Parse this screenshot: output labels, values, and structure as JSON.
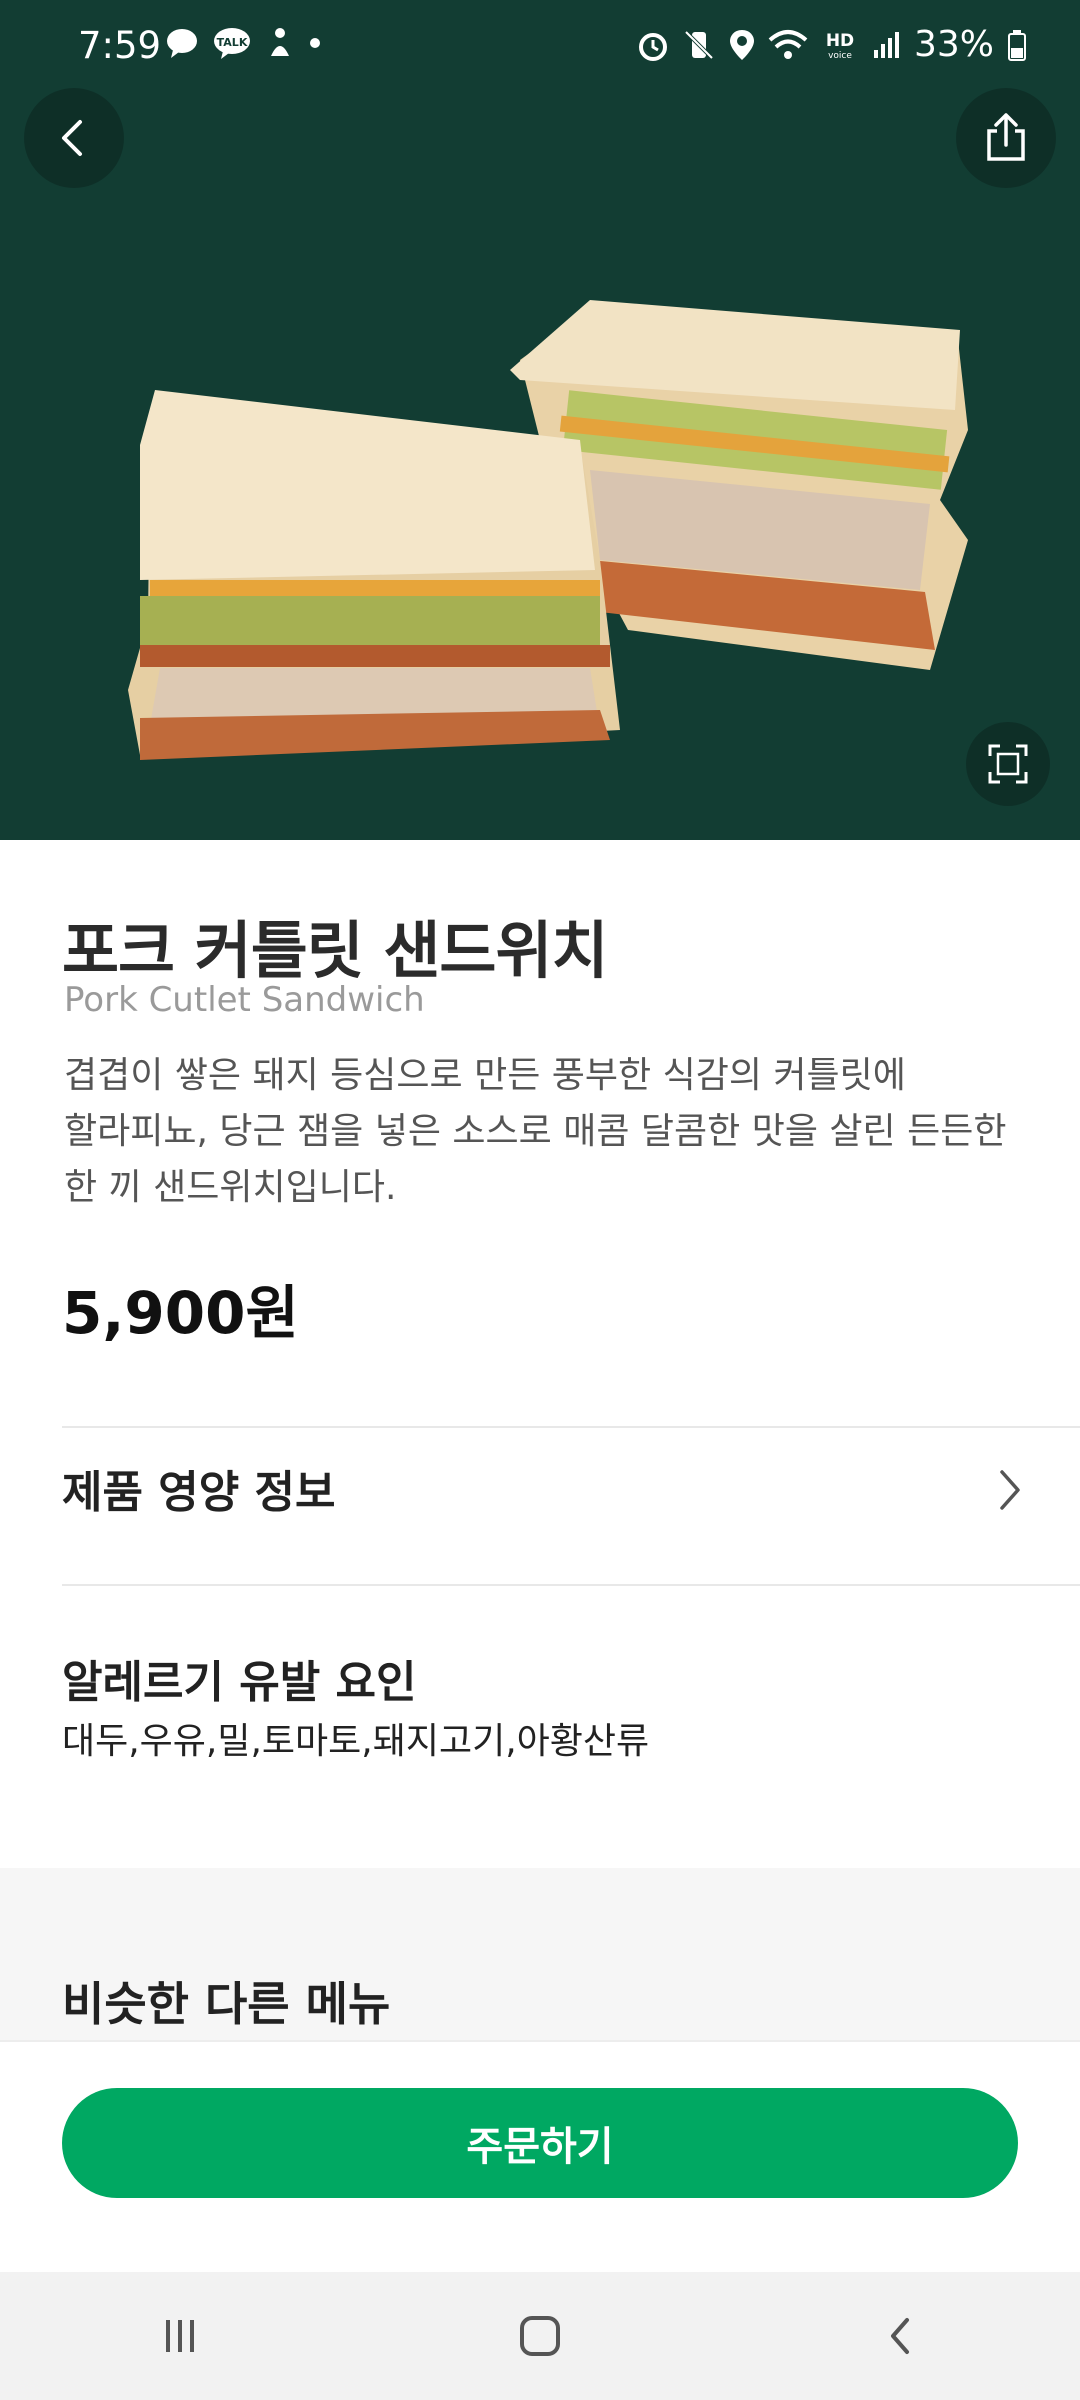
{
  "status_bar": {
    "time": "7:59",
    "left_icons": [
      "chat-bubble-icon",
      "talk-icon",
      "figure-icon",
      "dot-icon"
    ],
    "right_icons": [
      "alarm-icon",
      "vibrate-icon",
      "location-icon",
      "wifi-icon",
      "hd-voice-icon",
      "signal-icon",
      "battery-icon"
    ],
    "battery_percent": "33%"
  },
  "header": {
    "back_icon": "chevron-left-icon",
    "share_icon": "share-icon",
    "zoom_icon": "expand-icon"
  },
  "product": {
    "name": "포크 커틀릿 샌드위치",
    "name_en": "Pork Cutlet Sandwich",
    "description_lines": [
      "겹겹이 쌓은 돼지 등심으로 만든 풍부한 식감의 커틀릿에",
      "할라피뇨, 당근 잼을 넣은 소스로 매콤 달콤한 맛을 살린 든든한",
      "한 끼 샌드위치입니다."
    ],
    "price": "5,900원"
  },
  "nutrition": {
    "label": "제품 영양 정보"
  },
  "allergy": {
    "title": "알레르기 유발 요인",
    "value": "대두,우유,밀,토마토,돼지고기,아황산류"
  },
  "similar": {
    "title": "비슷한 다른 메뉴"
  },
  "order": {
    "label": "주문하기"
  },
  "colors": {
    "hero_bg": "#123d33",
    "accent": "#00a862"
  },
  "nav": {
    "icons": [
      "recent-apps-icon",
      "home-icon",
      "back-icon"
    ]
  }
}
